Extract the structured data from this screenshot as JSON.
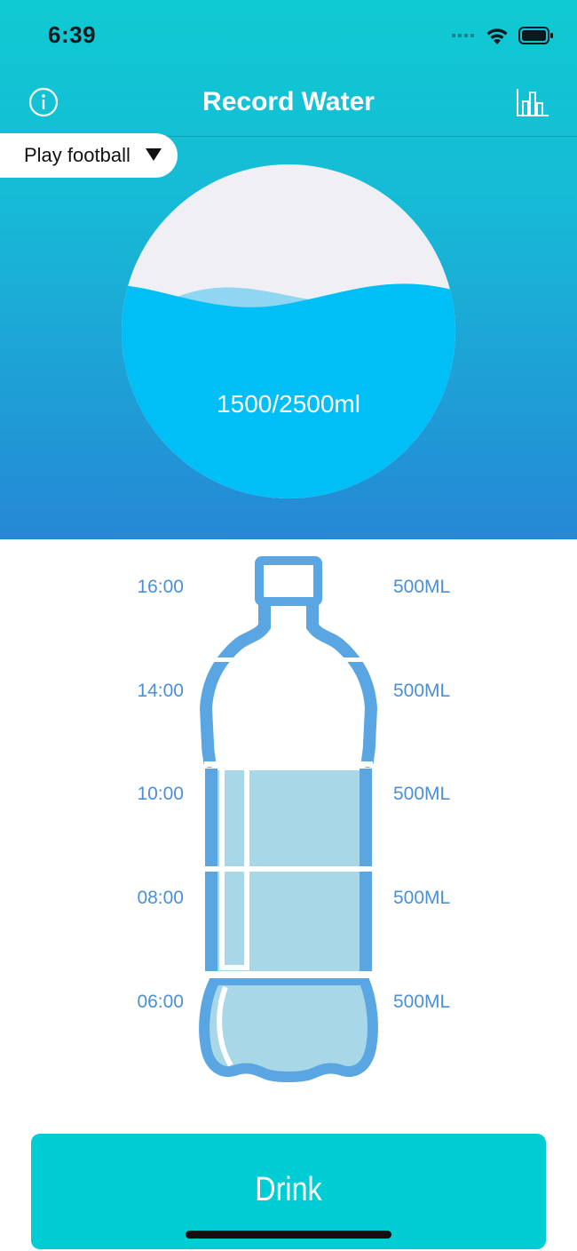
{
  "status_bar": {
    "time": "6:39"
  },
  "nav": {
    "title": "Record Water",
    "left_icon": "info-icon",
    "right_icon": "bar-chart-icon"
  },
  "activity": {
    "selected": "Play football"
  },
  "intake": {
    "label": "1500/2500ml",
    "current_ml": 1500,
    "goal_ml": 2500,
    "fill_fraction": 0.6
  },
  "bottle": {
    "segments": [
      {
        "time": "16:00",
        "amount": "500ML",
        "filled": false
      },
      {
        "time": "14:00",
        "amount": "500ML",
        "filled": false
      },
      {
        "time": "10:00",
        "amount": "500ML",
        "filled": true
      },
      {
        "time": "08:00",
        "amount": "500ML",
        "filled": true
      },
      {
        "time": "06:00",
        "amount": "500ML",
        "filled": true
      }
    ]
  },
  "drink_button": {
    "label": "Drink"
  },
  "colors": {
    "header_top": "#0fcad2",
    "header_bottom": "#2588d6",
    "water": "#00bff6",
    "water_back_wave": "#8fd6f2",
    "bottle_outline": "#59a6e2",
    "bottle_fill": "#a8d8e8",
    "label_blue": "#4a90d6",
    "button": "#00cdd3"
  }
}
